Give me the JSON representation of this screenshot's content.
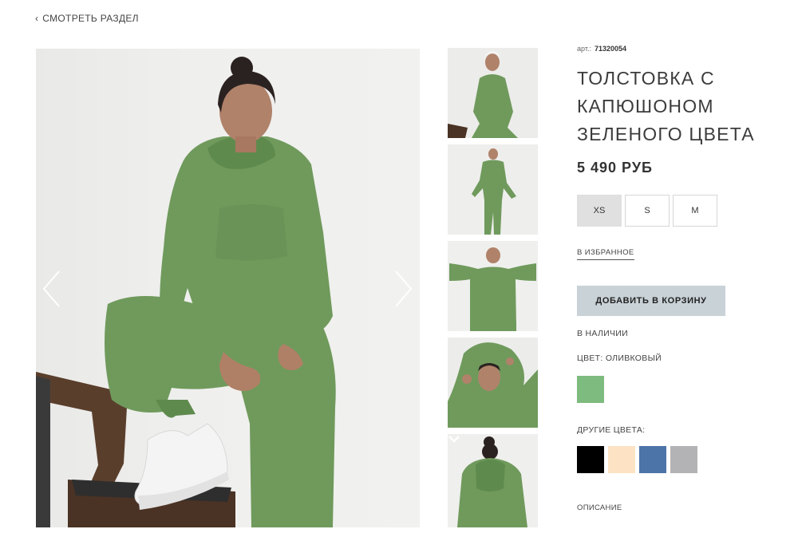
{
  "nav": {
    "back_label": "СМОТРЕТЬ РАЗДЕЛ",
    "back_icon": "chevron-left-icon"
  },
  "product": {
    "sku_label": "арт.:",
    "sku_value": "71320054",
    "title_lines": [
      "ТОЛСТОВКА С",
      "КАПЮШОНОМ",
      "ЗЕЛЕНОГО ЦВЕТА"
    ],
    "price": "5 490 РУБ",
    "sizes": [
      {
        "label": "XS",
        "selected": true
      },
      {
        "label": "S",
        "selected": false
      },
      {
        "label": "M",
        "selected": false
      }
    ],
    "favorite_label": "В ИЗБРАННОЕ",
    "add_to_cart_label": "ДОБАВИТЬ В КОРЗИНУ",
    "stock_status": "В НАЛИЧИИ",
    "color_label": "ЦВЕТ: ОЛИВКОВЫЙ",
    "current_color": "#7dbb7e",
    "other_colors_label": "ДРУГИЕ ЦВЕТА:",
    "other_colors": [
      "#000000",
      "#fde3c4",
      "#4c74a8",
      "#b3b3b5"
    ],
    "description_label": "ОПИСАНИЕ"
  },
  "gallery": {
    "garment_color": "#6f9a5c",
    "thumbnail_count": 5
  },
  "colors": {
    "cart_button_bg": "#c9d2d7",
    "selected_size_bg": "#e0e0e0"
  }
}
